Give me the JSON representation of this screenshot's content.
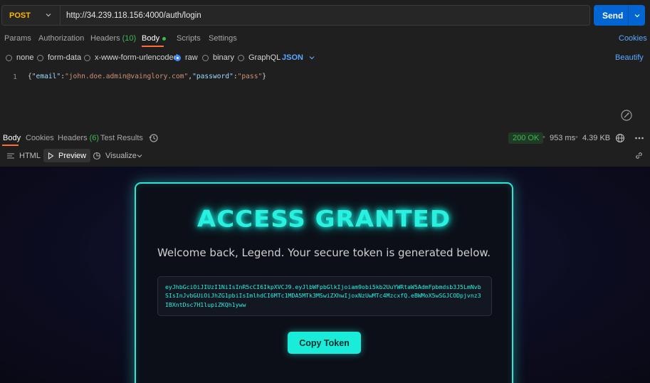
{
  "request": {
    "method": "POST",
    "url": "http://34.239.118.156:4000/auth/login",
    "send_label": "Send"
  },
  "request_tabs": {
    "params": "Params",
    "authorization": "Authorization",
    "headers": "Headers",
    "headers_count": "(10)",
    "body": "Body",
    "scripts": "Scripts",
    "settings": "Settings",
    "cookies": "Cookies"
  },
  "body_types": {
    "none": "none",
    "form_data": "form-data",
    "urlencoded": "x-www-form-urlencoded",
    "raw": "raw",
    "binary": "binary",
    "graphql": "GraphQL",
    "format": "JSON",
    "beautify": "Beautify",
    "selected": "raw"
  },
  "editor": {
    "line_number": "1",
    "tokens": {
      "open": "{",
      "email_key": "\"email\"",
      "colon1": ":",
      "email_val": "\"john.doe.admin@vainglory.com\"",
      "comma": ",",
      "password_key": "\"password\"",
      "colon2": ":",
      "password_val": "\"pass\"",
      "close": "}"
    }
  },
  "response_tabs": {
    "body": "Body",
    "cookies": "Cookies",
    "headers": "Headers",
    "headers_count": "(6)",
    "test_results": "Test Results"
  },
  "response_meta": {
    "status": "200 OK",
    "time": "953 ms",
    "size": "4.39 KB"
  },
  "view_modes": {
    "html": "HTML",
    "preview": "Preview",
    "visualize": "Visualize"
  },
  "preview_page": {
    "title": "ACCESS GRANTED",
    "welcome": "Welcome back, Legend. Your secure token is generated below.",
    "token": "eyJhbGciOiJIUzI1NiIsInR5cCI6IkpXVCJ9.eyJlbWFpbGlkIjoiam9obi5kb2UuYWRtaW5AdmFpbmdsb3J5LmNvbSIsInJvbGUiOiJhZG1pbiIsImlhdCI6MTc1MDA5MTk3MSwiZXhwIjoxNzUwMTc4MzcxfQ.eBWMoX5wSGJCODpjvnz3IBXntDsc7H1lupiZKQh1yww",
    "copy_label": "Copy Token"
  },
  "colors": {
    "accent_cyan": "#2af0e0",
    "send_blue": "#0265d2",
    "method_orange": "#ffb400",
    "status_green": "#3fb950",
    "tab_underline": "#ff6c37"
  }
}
